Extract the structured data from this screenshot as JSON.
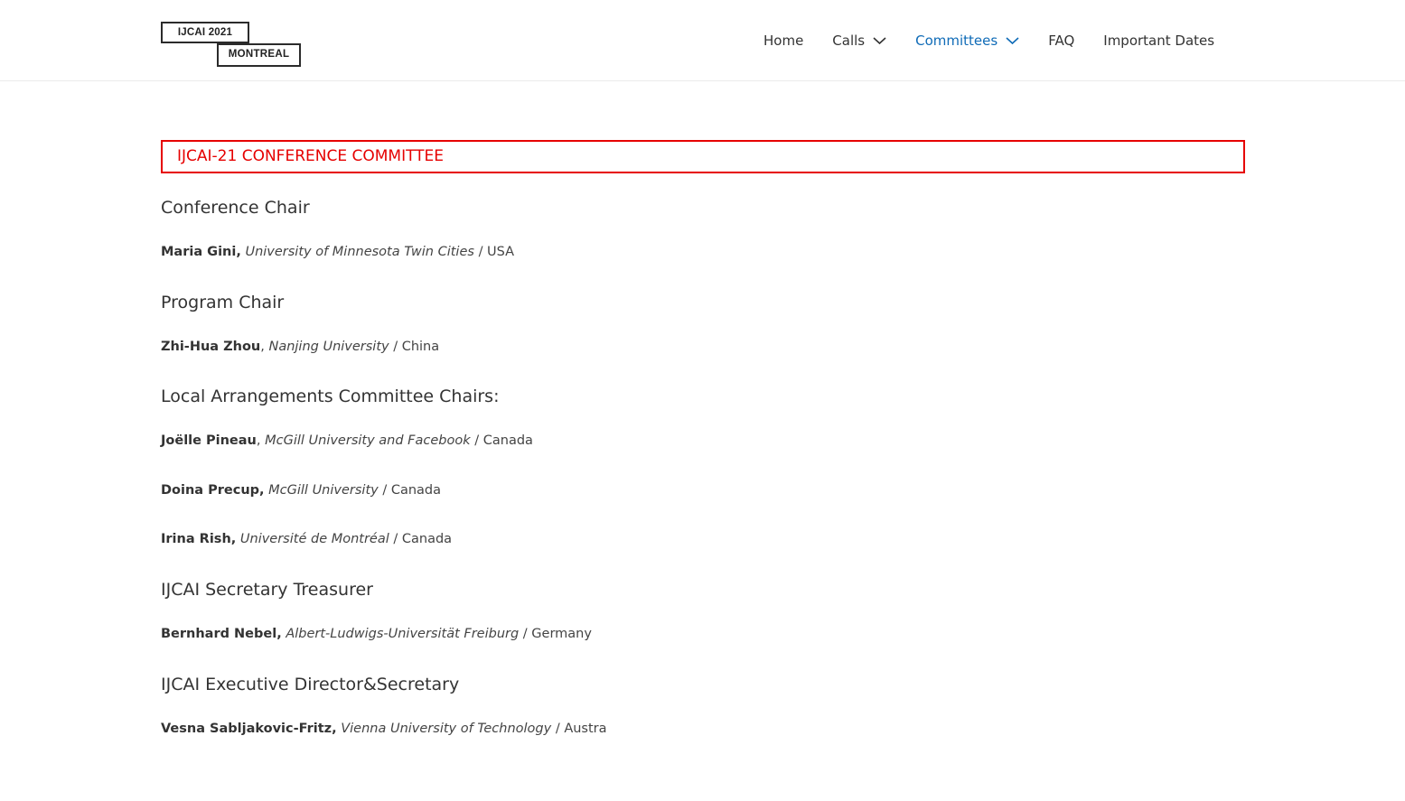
{
  "header": {
    "logo": {
      "line1": "IJCAI 2021",
      "line2": "MONTREAL"
    },
    "nav": [
      {
        "label": "Home",
        "has_dropdown": false,
        "active": false
      },
      {
        "label": "Calls",
        "has_dropdown": true,
        "active": false
      },
      {
        "label": "Committees",
        "has_dropdown": true,
        "active": true
      },
      {
        "label": "FAQ",
        "has_dropdown": false,
        "active": false
      },
      {
        "label": "Important Dates",
        "has_dropdown": false,
        "active": false
      }
    ]
  },
  "main": {
    "heading": "IJCAI-21 CONFERENCE COMMITTEE",
    "sections": [
      {
        "title": "Conference Chair",
        "people": [
          {
            "name": "Maria Gini,",
            "affiliation": "University of Minnesota Twin Cities",
            "country": "/ USA"
          }
        ]
      },
      {
        "title": "Program Chair",
        "people": [
          {
            "name": "Zhi-Hua Zhou",
            "sep": ", ",
            "affiliation": "Nanjing University",
            "country": "/ China"
          }
        ]
      },
      {
        "title": "Local Arrangements Committee Chairs:",
        "people": [
          {
            "name": "Joëlle Pineau",
            "sep": ", ",
            "affiliation": "McGill University and Facebook",
            "country": "/ Canada"
          },
          {
            "name": "Doina Precup,",
            "affiliation": "McGill University",
            "country": "/ Canada"
          },
          {
            "name": "Irina Rish,",
            "affiliation": "Université de Montréal",
            "country": "/ Canada"
          }
        ]
      },
      {
        "title": "IJCAI Secretary Treasurer",
        "people": [
          {
            "name": "Bernhard Nebel,",
            "affiliation": "Albert-Ludwigs-Universität Freiburg",
            "country": "/ Germany"
          }
        ]
      },
      {
        "title": "IJCAI Executive Director&Secretary",
        "people": [
          {
            "name": "Vesna Sabljakovic-Fritz,",
            "affiliation": "Vienna University of Technology",
            "country": "/ Austra"
          }
        ]
      }
    ]
  },
  "colors": {
    "accent_red": "#e60000",
    "active_nav": "#0f6bb7",
    "text": "#333333"
  }
}
